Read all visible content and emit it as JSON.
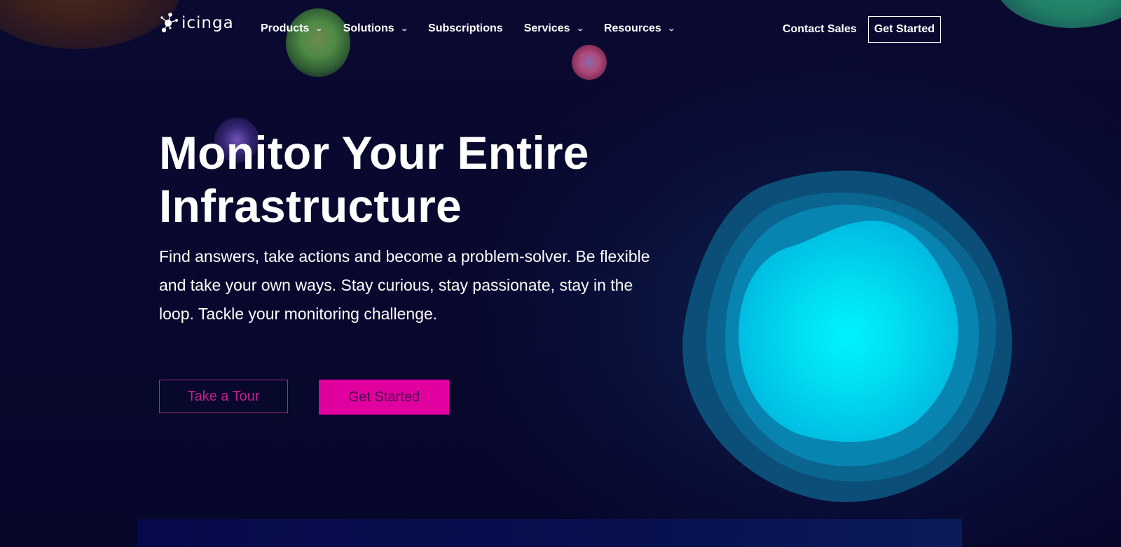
{
  "brand": {
    "name": "icinga",
    "logo_icon": "molecule-network-icon"
  },
  "nav": {
    "items": [
      {
        "label": "Products",
        "has_dropdown": true
      },
      {
        "label": "Solutions",
        "has_dropdown": true
      },
      {
        "label": "Subscriptions",
        "has_dropdown": false
      },
      {
        "label": "Services",
        "has_dropdown": true
      },
      {
        "label": "Resources",
        "has_dropdown": true
      }
    ],
    "dropdown_icon": "chevron-down-icon",
    "contact_label": "Contact Sales",
    "get_started_label": "Get Started"
  },
  "hero": {
    "title_line1": "Monitor Your Entire",
    "title_line2": "Infrastructure",
    "description": "Find answers, take actions and become a problem-solver. Be flexible and take your own ways. Stay curious, stay passionate, stay in the loop. Tackle your monitoring challenge.",
    "tour_label": "Take a Tour",
    "start_label": "Get Started"
  },
  "colors": {
    "background": "#07062b",
    "accent_magenta": "#e0009f",
    "tour_text": "#c1208f",
    "orb_core": "#00f2ff",
    "orb_outer": "#0b4f78"
  }
}
